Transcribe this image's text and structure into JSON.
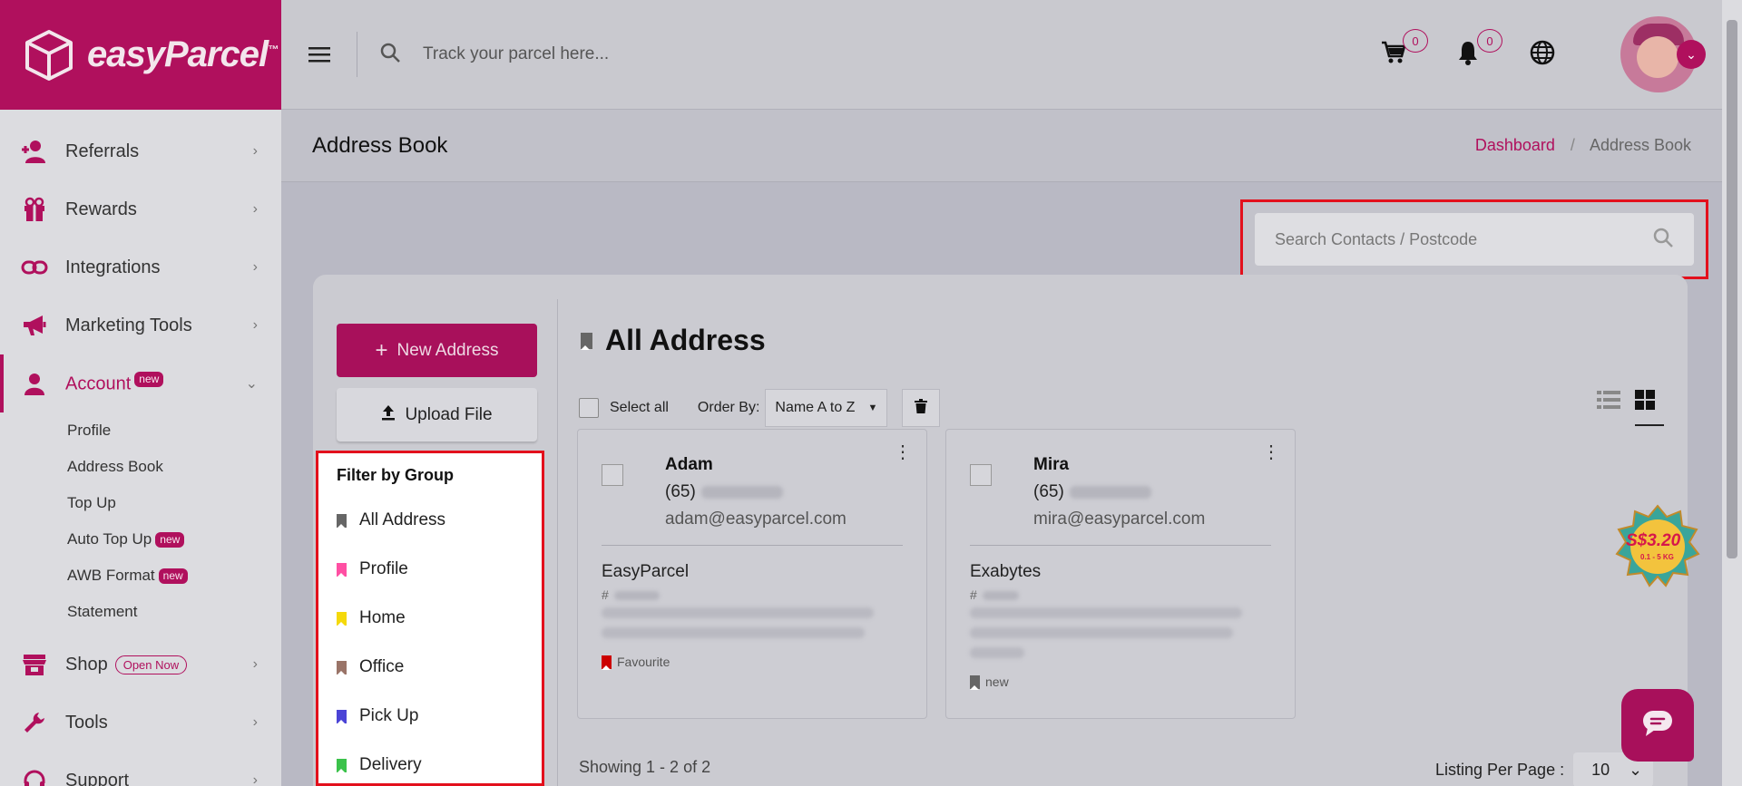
{
  "brand": {
    "name": "easyParcel",
    "tm": "™",
    "color": "#b0105d"
  },
  "topbar": {
    "search_placeholder": "Track your parcel here...",
    "cart_count": "0",
    "notif_count": "0"
  },
  "sidebar": {
    "items": [
      {
        "label": "Referrals",
        "icon": "referral-icon"
      },
      {
        "label": "Rewards",
        "icon": "gift-icon"
      },
      {
        "label": "Integrations",
        "icon": "link-icon"
      },
      {
        "label": "Marketing Tools",
        "icon": "megaphone-icon"
      },
      {
        "label": "Account",
        "icon": "user-icon",
        "badge": "new"
      },
      {
        "label": "Shop",
        "icon": "shop-icon",
        "badge": "Open Now"
      },
      {
        "label": "Tools",
        "icon": "wrench-icon"
      },
      {
        "label": "Support",
        "icon": "headset-icon"
      }
    ],
    "account_sub": [
      {
        "label": "Profile"
      },
      {
        "label": "Address Book"
      },
      {
        "label": "Top Up"
      },
      {
        "label": "Auto Top Up",
        "badge": "new"
      },
      {
        "label": "AWB Format",
        "badge": "new"
      },
      {
        "label": "Statement"
      }
    ]
  },
  "header": {
    "title": "Address Book",
    "breadcrumb": {
      "home": "Dashboard",
      "sep": "/",
      "current": "Address Book"
    }
  },
  "search_contacts": {
    "placeholder": "Search Contacts / Postcode"
  },
  "actions": {
    "new_address": "New Address",
    "upload_file": "Upload File"
  },
  "filter": {
    "title": "Filter by Group",
    "groups": [
      {
        "label": "All Address",
        "color": "#666666"
      },
      {
        "label": "Profile",
        "color": "#ff4fa3"
      },
      {
        "label": "Home",
        "color": "#f5d90a"
      },
      {
        "label": "Office",
        "color": "#9a7468"
      },
      {
        "label": "Pick Up",
        "color": "#4b44d6"
      },
      {
        "label": "Delivery",
        "color": "#3bc24b"
      }
    ]
  },
  "list": {
    "title": "All Address",
    "select_all": "Select all",
    "order_by_label": "Order By:",
    "order_by_value": "Name A to Z"
  },
  "contacts": [
    {
      "name": "Adam",
      "phone_prefix": "(65)",
      "email": "adam@easyparcel.com",
      "company": "EasyParcel",
      "ref_prefix": "#",
      "tag": "Favourite",
      "tag_color": "#cc0000"
    },
    {
      "name": "Mira",
      "phone_prefix": "(65)",
      "email": "mira@easyparcel.com",
      "company": "Exabytes",
      "ref_prefix": "#",
      "tag": "new",
      "tag_color": "#666666"
    }
  ],
  "footer": {
    "showing": "Showing 1 - 2 of 2",
    "per_page_label": "Listing Per Page :",
    "per_page_value": "10"
  },
  "promo": {
    "price": "S$3.20",
    "sub": "0.1 - 5 KG"
  }
}
